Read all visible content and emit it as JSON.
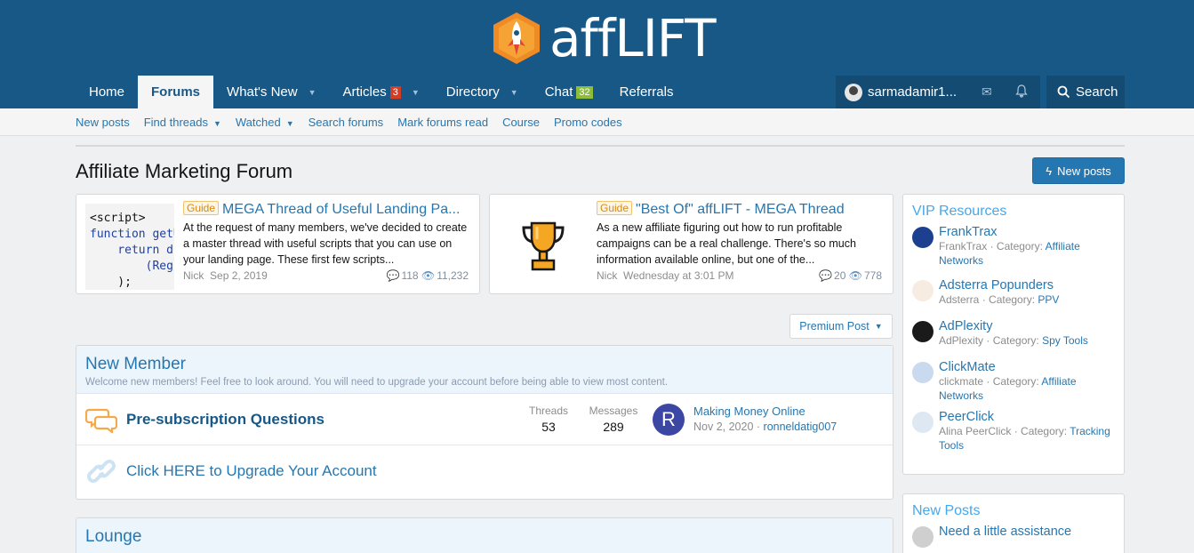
{
  "header": {
    "logo_text": "affLIFT",
    "nav": [
      {
        "label": "Home"
      },
      {
        "label": "Forums"
      },
      {
        "label": "What's New"
      },
      {
        "label": "Articles",
        "badge": "3"
      },
      {
        "label": "Directory"
      },
      {
        "label": "Chat",
        "badge": "32"
      },
      {
        "label": "Referrals"
      }
    ],
    "username": "sarmadamir1...",
    "search_label": "Search"
  },
  "subnav": [
    "New posts",
    "Find threads",
    "Watched",
    "Search forums",
    "Mark forums read",
    "Course",
    "Promo codes"
  ],
  "page": {
    "title": "Affiliate Marketing Forum",
    "new_posts_label": "New posts",
    "premium_label": "Premium Post"
  },
  "featured": [
    {
      "tag": "Guide",
      "title": "MEGA Thread of Useful Landing Pa...",
      "snippet": "At the request of many members, we've decided to create a master thread with useful scripts that you can use on your landing page. These first few scripts...",
      "author": "Nick",
      "date": "Sep 2, 2019",
      "replies": "118",
      "views": "11,232",
      "code_lines": [
        "<script>",
        "function getU",
        "    return d",
        "        (Reg",
        "    );"
      ]
    },
    {
      "tag": "Guide",
      "title": "\"Best Of\" affLIFT - MEGA Thread",
      "snippet": "As a new affiliate figuring out how to run profitable campaigns can be a real challenge. There's so much information available online, but one of the...",
      "author": "Nick",
      "date": "Wednesday at 3:01 PM",
      "replies": "20",
      "views": "778"
    }
  ],
  "new_member": {
    "title": "New Member",
    "description": "Welcome new members! Feel free to look around. You will need to upgrade your account before being able to view most content.",
    "nodes": [
      {
        "title": "Pre-subscription Questions",
        "threads_label": "Threads",
        "threads": "53",
        "messages_label": "Messages",
        "messages": "289",
        "last_avatar": "R",
        "last_title": "Making Money Online",
        "last_date": "Nov 2, 2020",
        "last_user": "ronneldatig007"
      },
      {
        "title": "Click HERE to Upgrade Your Account"
      }
    ]
  },
  "lounge": {
    "title": "Lounge"
  },
  "sidebar": {
    "vip_title": "VIP Resources",
    "resources": [
      {
        "name": "FrankTrax",
        "author": "FrankTrax",
        "category": "Affiliate Networks",
        "color": "#1d3f8f"
      },
      {
        "name": "Adsterra Popunders",
        "author": "Adsterra",
        "category": "PPV",
        "color": "#f3e3d0"
      },
      {
        "name": "AdPlexity",
        "author": "AdPlexity",
        "category": "Spy Tools",
        "color": "#1a1a1a"
      },
      {
        "name": "ClickMate",
        "author": "clickmate",
        "category": "Affiliate Networks",
        "color": "#c9d9ee"
      },
      {
        "name": "PeerClick",
        "author": "Alina PeerClick",
        "category": "Tracking Tools",
        "color": "#dde8f3"
      }
    ],
    "category_prefix": "Category:",
    "new_posts_title": "New Posts",
    "new_posts": [
      {
        "title": "Need a little assistance"
      }
    ]
  }
}
